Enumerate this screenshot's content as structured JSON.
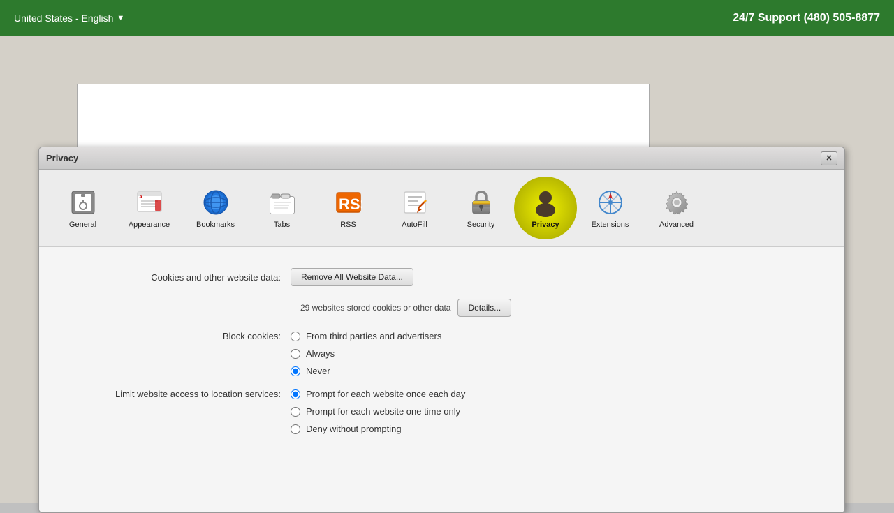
{
  "topbar": {
    "region": "United States - English",
    "chevron": "▼",
    "support": "24/7 Support (480) 505-8877"
  },
  "dialog": {
    "title": "Privacy",
    "close_label": "✕",
    "toolbar": {
      "items": [
        {
          "id": "general",
          "label": "General",
          "icon": "general"
        },
        {
          "id": "appearance",
          "label": "Appearance",
          "icon": "appearance"
        },
        {
          "id": "bookmarks",
          "label": "Bookmarks",
          "icon": "bookmarks"
        },
        {
          "id": "tabs",
          "label": "Tabs",
          "icon": "tabs"
        },
        {
          "id": "rss",
          "label": "RSS",
          "icon": "rss"
        },
        {
          "id": "autofill",
          "label": "AutoFill",
          "icon": "autofill"
        },
        {
          "id": "security",
          "label": "Security",
          "icon": "security"
        },
        {
          "id": "privacy",
          "label": "Privacy",
          "icon": "privacy",
          "active": true
        },
        {
          "id": "extensions",
          "label": "Extensions",
          "icon": "extensions"
        },
        {
          "id": "advanced",
          "label": "Advanced",
          "icon": "advanced"
        }
      ]
    },
    "content": {
      "cookies_label": "Cookies and other website data:",
      "remove_all_btn": "Remove All Website Data...",
      "stored_info": "29 websites stored cookies or other data",
      "details_btn": "Details...",
      "block_cookies_label": "Block cookies:",
      "block_cookies_options": [
        {
          "id": "third_parties",
          "label": "From third parties and advertisers",
          "checked": false
        },
        {
          "id": "always",
          "label": "Always",
          "checked": false
        },
        {
          "id": "never",
          "label": "Never",
          "checked": true
        }
      ],
      "location_label": "Limit website access to location services:",
      "location_options": [
        {
          "id": "prompt_each_day",
          "label": "Prompt for each website once each day",
          "checked": true
        },
        {
          "id": "prompt_one_time",
          "label": "Prompt for each website one time only",
          "checked": false
        },
        {
          "id": "deny",
          "label": "Deny without prompting",
          "checked": false
        }
      ]
    }
  }
}
